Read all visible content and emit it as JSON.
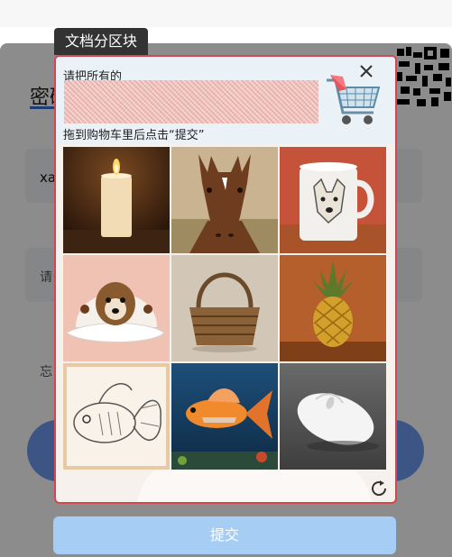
{
  "background": {
    "tab_label": "密码",
    "username_value": "xa",
    "password_placeholder": "请",
    "forgot_link": "忘"
  },
  "label_tag": "文档分区块",
  "captcha": {
    "instruction_prefix": "请把所有的",
    "instruction_suffix": "拖到购物车里后点击“提交”",
    "images": [
      {
        "name": "candle"
      },
      {
        "name": "horse"
      },
      {
        "name": "dog-mug"
      },
      {
        "name": "dog-cap"
      },
      {
        "name": "basket"
      },
      {
        "name": "pineapple"
      },
      {
        "name": "fish-drawing"
      },
      {
        "name": "goldfish"
      },
      {
        "name": "mouse"
      }
    ],
    "submit_label": "提交"
  },
  "colors": {
    "accent_border": "#d64550",
    "submit_bg": "#a6cdf3",
    "login_button": "#6f9cf0"
  }
}
